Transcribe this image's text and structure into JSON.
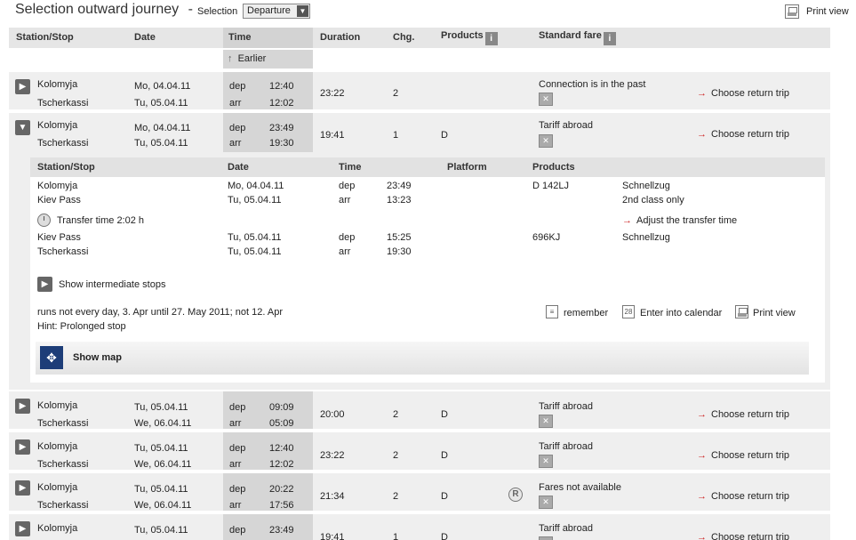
{
  "page": {
    "title": "Selection outward journey",
    "title_sep": "-",
    "selection_label": "Selection",
    "selection_value": "Departure",
    "print_view": "Print view"
  },
  "columns": {
    "station": "Station/Stop",
    "date": "Date",
    "time": "Time",
    "duration": "Duration",
    "changes": "Chg.",
    "products": "Products",
    "fare": "Standard fare"
  },
  "earlier_label": "Earlier",
  "connections": [
    {
      "from": "Kolomyja",
      "to": "Tscherkassi",
      "date_dep": "Mo, 04.04.11",
      "date_arr": "Tu, 05.04.11",
      "dep_label": "dep",
      "arr_label": "arr",
      "time_dep": "12:40",
      "time_arr": "12:02",
      "duration": "23:22",
      "changes": "2",
      "products": "",
      "fare": "Connection is in the past",
      "action": "Choose return trip"
    },
    {
      "from": "Kolomyja",
      "to": "Tscherkassi",
      "date_dep": "Mo, 04.04.11",
      "date_arr": "Tu, 05.04.11",
      "dep_label": "dep",
      "arr_label": "arr",
      "time_dep": "23:49",
      "time_arr": "19:30",
      "duration": "19:41",
      "changes": "1",
      "products": "D",
      "fare": "Tariff abroad",
      "action": "Choose return trip"
    },
    {
      "from": "Kolomyja",
      "to": "Tscherkassi",
      "date_dep": "Tu, 05.04.11",
      "date_arr": "We, 06.04.11",
      "dep_label": "dep",
      "arr_label": "arr",
      "time_dep": "09:09",
      "time_arr": "05:09",
      "duration": "20:00",
      "changes": "2",
      "products": "D",
      "fare": "Tariff abroad",
      "action": "Choose return trip"
    },
    {
      "from": "Kolomyja",
      "to": "Tscherkassi",
      "date_dep": "Tu, 05.04.11",
      "date_arr": "We, 06.04.11",
      "dep_label": "dep",
      "arr_label": "arr",
      "time_dep": "12:40",
      "time_arr": "12:02",
      "duration": "23:22",
      "changes": "2",
      "products": "D",
      "fare": "Tariff abroad",
      "action": "Choose return trip"
    },
    {
      "from": "Kolomyja",
      "to": "Tscherkassi",
      "date_dep": "Tu, 05.04.11",
      "date_arr": "We, 06.04.11",
      "dep_label": "dep",
      "arr_label": "arr",
      "time_dep": "20:22",
      "time_arr": "17:56",
      "duration": "21:34",
      "changes": "2",
      "products": "D",
      "fare": "Fares not available",
      "action": "Choose return trip",
      "r_badge": "R"
    },
    {
      "from": "Kolomyja",
      "to": "",
      "date_dep": "Tu, 05.04.11",
      "date_arr": "",
      "dep_label": "dep",
      "arr_label": "",
      "time_dep": "23:49",
      "time_arr": "",
      "duration": "19:41",
      "changes": "1",
      "products": "D",
      "fare": "Tariff abroad",
      "action": "Choose return trip"
    }
  ],
  "detail": {
    "headers": {
      "station": "Station/Stop",
      "date": "Date",
      "time": "Time",
      "platform": "Platform",
      "products": "Products"
    },
    "legs": [
      {
        "station": "Kolomyja",
        "date": "Mo, 04.04.11",
        "kind": "dep",
        "time": "23:49",
        "product": "D 142LJ",
        "note": "Schnellzug"
      },
      {
        "station": "Kiev Pass",
        "date": "Tu, 05.04.11",
        "kind": "arr",
        "time": "13:23",
        "product": "",
        "note": "2nd class only"
      },
      {
        "station": "Kiev Pass",
        "date": "Tu, 05.04.11",
        "kind": "dep",
        "time": "15:25",
        "product": "696KJ",
        "note": "Schnellzug"
      },
      {
        "station": "Tscherkassi",
        "date": "Tu, 05.04.11",
        "kind": "arr",
        "time": "19:30",
        "product": "",
        "note": ""
      }
    ],
    "transfer_time": "Transfer time 2:02 h",
    "adjust_transfer": "Adjust the transfer time",
    "show_intermediate": "Show intermediate stops",
    "runs_note": "runs not every day, 3. Apr until 27. May 2011; not 12. Apr",
    "hint": "Hint: Prolonged stop",
    "remember": "remember",
    "calendar": "Enter into calendar",
    "calendar_icon_text": "28",
    "print_view": "Print view",
    "show_map": "Show map"
  },
  "icons": {
    "expand": "chevron-right-icon",
    "collapse": "chevron-down-icon",
    "info": "info-icon",
    "fare": "ticket-icon",
    "print": "printer-icon",
    "clock": "clock-icon",
    "map": "map-icon"
  },
  "colors": {
    "accent_arrow": "#cc2222",
    "header_bg": "#e6e6e6",
    "row_bg": "#efefef",
    "time_bg": "#d6d6d6",
    "map_icon": "#1d3d78"
  }
}
